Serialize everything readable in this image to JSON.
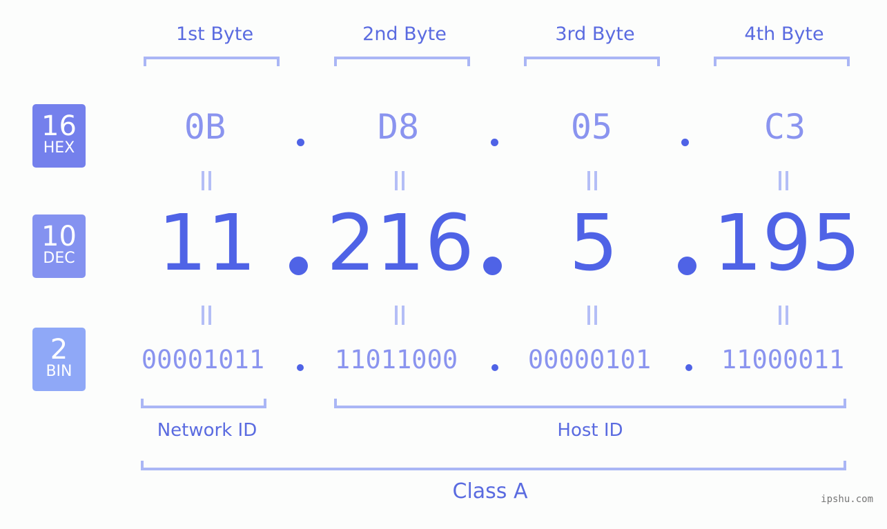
{
  "badges": [
    {
      "num": "16",
      "label": "HEX",
      "color": "#7480ec"
    },
    {
      "num": "10",
      "label": "DEC",
      "color": "#8492f0"
    },
    {
      "num": "2",
      "label": "BIN",
      "color": "#8fa8f7"
    }
  ],
  "bytes": [
    {
      "title": "1st Byte",
      "hex": "0B",
      "dec": "11",
      "bin": "00001011"
    },
    {
      "title": "2nd Byte",
      "hex": "D8",
      "dec": "216",
      "bin": "11011000"
    },
    {
      "title": "3rd Byte",
      "hex": "05",
      "dec": "5",
      "bin": "00000101"
    },
    {
      "title": "4th Byte",
      "hex": "C3",
      "dec": "195",
      "bin": "11000011"
    }
  ],
  "labels": {
    "network_id": "Network ID",
    "host_id": "Host ID",
    "class": "Class A"
  },
  "watermark": "ipshu.com"
}
